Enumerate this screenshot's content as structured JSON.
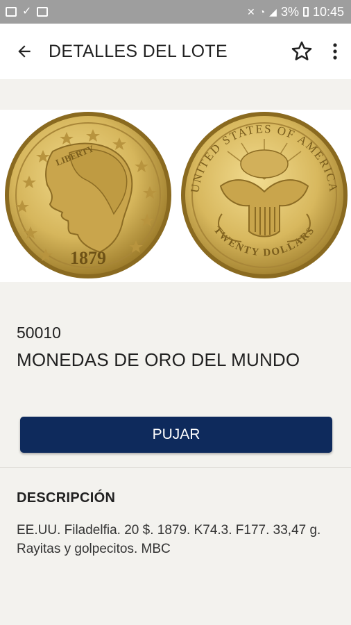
{
  "status_bar": {
    "battery": "3%",
    "time": "10:45"
  },
  "app_bar": {
    "title": "DETALLES DEL LOTE"
  },
  "coins": {
    "obverse_year": "1879",
    "obverse_legend": "LIBERTY",
    "reverse_legend": "UNITED STATES OF AMERICA",
    "reverse_denomination": "TWENTY DOLLARS"
  },
  "lot": {
    "number": "50010",
    "title": "MONEDAS DE ORO DEL MUNDO"
  },
  "actions": {
    "bid_label": "PUJAR"
  },
  "description": {
    "heading": "DESCRIPCIÓN",
    "text": "EE.UU. Filadelfia. 20 $. 1879. K74.3. F177. 33,47 g. Rayitas y golpecitos. MBC"
  },
  "colors": {
    "accent": "#0e2a5c",
    "status_bar": "#9e9e9e",
    "coin_gold": "#d6b65c"
  },
  "icons": [
    "back-arrow-icon",
    "star-outline-icon",
    "more-vert-icon"
  ]
}
